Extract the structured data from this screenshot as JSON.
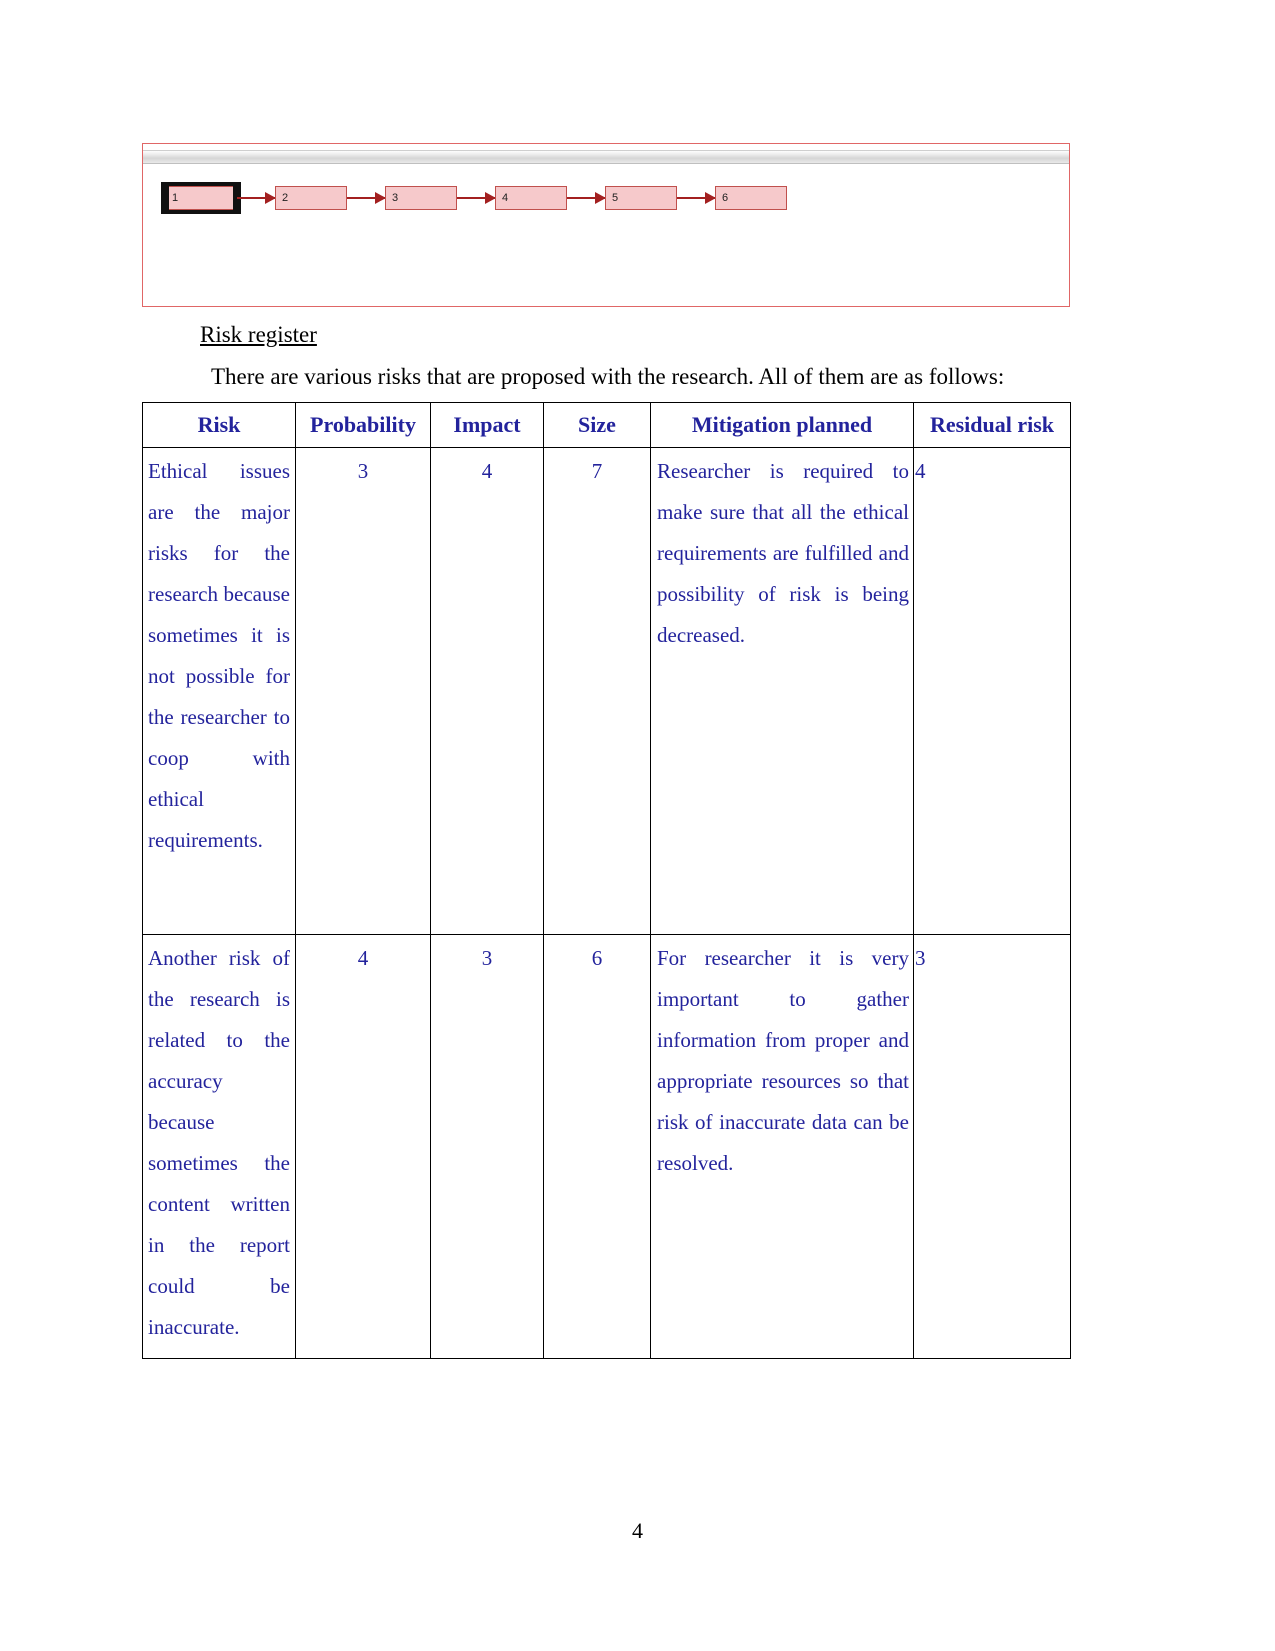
{
  "document": {
    "page_number": "4"
  },
  "diagram": {
    "name": "gantt-task-chain",
    "tasks": [
      {
        "label": "1",
        "selected": true
      },
      {
        "label": "2",
        "selected": false
      },
      {
        "label": "3",
        "selected": false
      },
      {
        "label": "4",
        "selected": false
      },
      {
        "label": "5",
        "selected": false
      },
      {
        "label": "6",
        "selected": false
      }
    ],
    "colors": {
      "box_fill": "#f6c9cb",
      "box_border": "#c0504d",
      "connector": "#a32020",
      "frame_border": "#e06666",
      "selection": "#111111"
    }
  },
  "section": {
    "heading": "Risk register",
    "intro": "There are various risks that are proposed with the research. All of them are as follows:"
  },
  "table": {
    "accent_color": "#23239c",
    "headers": [
      "Risk",
      "Probability",
      "Impact",
      "Size",
      "Mitigation planned",
      "Residual risk"
    ],
    "rows": [
      {
        "risk": "Ethical issues are the major risks for the research because sometimes it is not possible for the researcher to coop with ethical requirements.",
        "probability": "3",
        "impact": "4",
        "size": "7",
        "mitigation": "Researcher is required to make sure that all the ethical requirements are fulfilled and possibility of risk is being decreased.",
        "residual_risk": "4"
      },
      {
        "risk": "Another risk of the research is related to the accuracy because sometimes the content written in the report could be inaccurate.",
        "probability": "4",
        "impact": "3",
        "size": "6",
        "mitigation": "For researcher it is very important to gather information from proper and appropriate resources so that risk of inaccurate data can be resolved.",
        "residual_risk": "3"
      }
    ]
  }
}
